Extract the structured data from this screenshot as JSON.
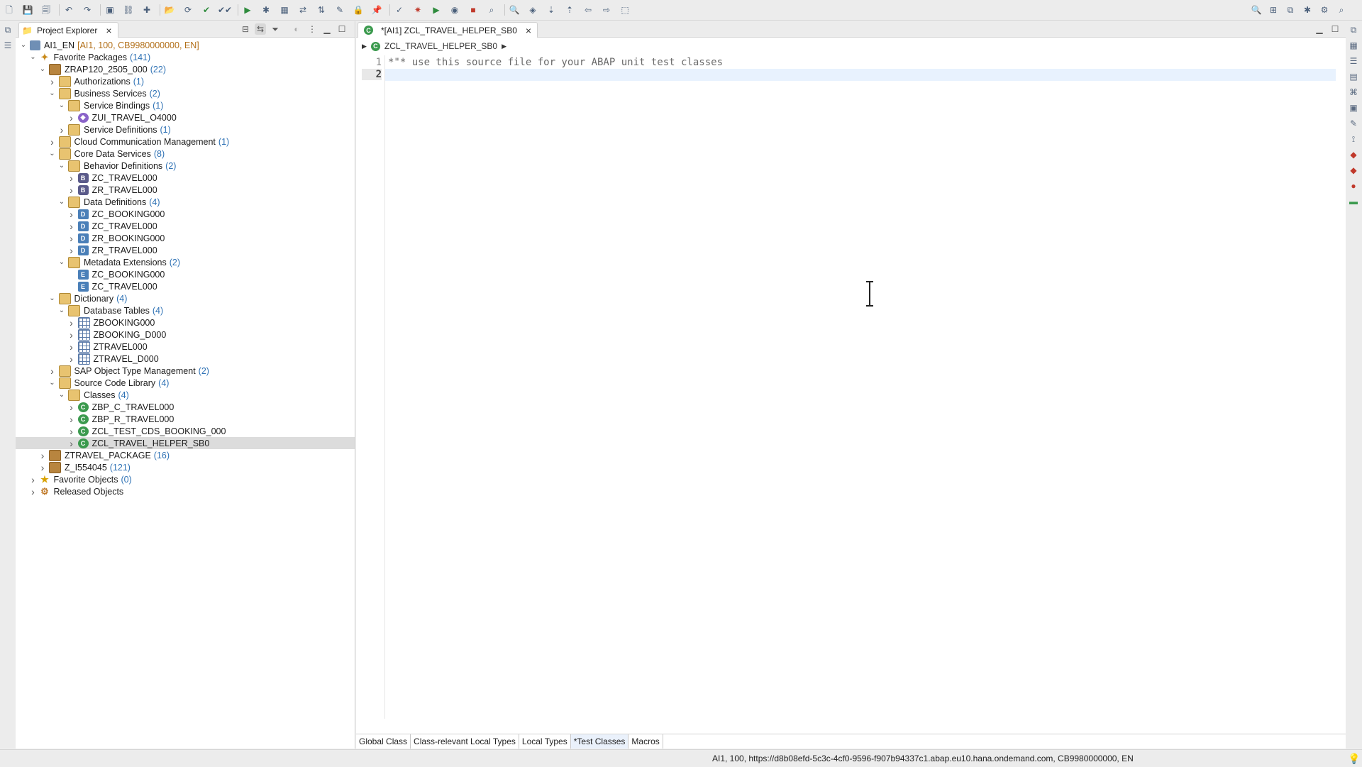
{
  "toolbar": {
    "left_icons": [
      "new-icon",
      "save-icon",
      "save-all-icon",
      "undo-icon",
      "redo-icon",
      "open-console-icon",
      "link-icon",
      "new-abap-object-icon",
      "open-abap-icon",
      "refresh-icon",
      "activate-icon",
      "activate-all-icon",
      "run-icon",
      "debug-icon",
      "package-icon",
      "transport-icon",
      "sync-icon",
      "edit-icon",
      "lock-icon",
      "pin-icon",
      "mark-icon",
      "bug-icon",
      "run-menu-icon",
      "coverage-icon",
      "stop-icon",
      "open-type-icon",
      "search-icon",
      "annotation-icon",
      "next-annotation-icon",
      "prev-annotation-icon",
      "back-icon",
      "forward-icon",
      "maximize-editor-icon"
    ],
    "right_icons": [
      "search-icon",
      "open-perspective-icon",
      "abap-perspective-icon",
      "debug-perspective-icon",
      "settings-icon",
      "search-perspective-icon"
    ]
  },
  "explorer": {
    "title": "Project Explorer",
    "tree": [
      {
        "depth": 0,
        "twisty": "open",
        "icon": "project",
        "name": "AI1_EN",
        "meta": "[AI1, 100, CB9980000000, EN]"
      },
      {
        "depth": 1,
        "twisty": "open",
        "icon": "fav",
        "name": "Favorite Packages",
        "count": "(141)"
      },
      {
        "depth": 2,
        "twisty": "open",
        "icon": "package",
        "name": "ZRAP120_2505_000",
        "count": "(22)"
      },
      {
        "depth": 3,
        "twisty": "closed",
        "icon": "folder",
        "name": "Authorizations",
        "count": "(1)"
      },
      {
        "depth": 3,
        "twisty": "open",
        "icon": "folder",
        "name": "Business Services",
        "count": "(2)"
      },
      {
        "depth": 4,
        "twisty": "open",
        "icon": "folder",
        "name": "Service Bindings",
        "count": "(1)"
      },
      {
        "depth": 5,
        "twisty": "closed",
        "icon": "binding",
        "name": "ZUI_TRAVEL_O4000"
      },
      {
        "depth": 4,
        "twisty": "closed",
        "icon": "folder",
        "name": "Service Definitions",
        "count": "(1)"
      },
      {
        "depth": 3,
        "twisty": "closed",
        "icon": "folder",
        "name": "Cloud Communication Management",
        "count": "(1)"
      },
      {
        "depth": 3,
        "twisty": "open",
        "icon": "folder",
        "name": "Core Data Services",
        "count": "(8)"
      },
      {
        "depth": 4,
        "twisty": "open",
        "icon": "folder",
        "name": "Behavior Definitions",
        "count": "(2)"
      },
      {
        "depth": 5,
        "twisty": "closed",
        "icon": "bdef",
        "glyph": "B",
        "name": "ZC_TRAVEL000"
      },
      {
        "depth": 5,
        "twisty": "closed",
        "icon": "bdef",
        "glyph": "B",
        "name": "ZR_TRAVEL000"
      },
      {
        "depth": 4,
        "twisty": "open",
        "icon": "folder",
        "name": "Data Definitions",
        "count": "(4)"
      },
      {
        "depth": 5,
        "twisty": "closed",
        "icon": "ddl",
        "glyph": "D",
        "name": "ZC_BOOKING000"
      },
      {
        "depth": 5,
        "twisty": "closed",
        "icon": "ddl",
        "glyph": "D",
        "name": "ZC_TRAVEL000"
      },
      {
        "depth": 5,
        "twisty": "closed",
        "icon": "ddl",
        "glyph": "D",
        "name": "ZR_BOOKING000"
      },
      {
        "depth": 5,
        "twisty": "closed",
        "icon": "ddl",
        "glyph": "D",
        "name": "ZR_TRAVEL000"
      },
      {
        "depth": 4,
        "twisty": "open",
        "icon": "folder",
        "name": "Metadata Extensions",
        "count": "(2)"
      },
      {
        "depth": 5,
        "twisty": "none",
        "icon": "ext",
        "glyph": "E",
        "name": "ZC_BOOKING000"
      },
      {
        "depth": 5,
        "twisty": "none",
        "icon": "ext",
        "glyph": "E",
        "name": "ZC_TRAVEL000"
      },
      {
        "depth": 3,
        "twisty": "open",
        "icon": "folder",
        "name": "Dictionary",
        "count": "(4)"
      },
      {
        "depth": 4,
        "twisty": "open",
        "icon": "folder",
        "name": "Database Tables",
        "count": "(4)"
      },
      {
        "depth": 5,
        "twisty": "closed",
        "icon": "table",
        "name": "ZBOOKING000"
      },
      {
        "depth": 5,
        "twisty": "closed",
        "icon": "table",
        "name": "ZBOOKING_D000"
      },
      {
        "depth": 5,
        "twisty": "closed",
        "icon": "table",
        "name": "ZTRAVEL000"
      },
      {
        "depth": 5,
        "twisty": "closed",
        "icon": "table",
        "name": "ZTRAVEL_D000"
      },
      {
        "depth": 3,
        "twisty": "closed",
        "icon": "folder",
        "name": "SAP Object Type Management",
        "count": "(2)"
      },
      {
        "depth": 3,
        "twisty": "open",
        "icon": "folder",
        "name": "Source Code Library",
        "count": "(4)"
      },
      {
        "depth": 4,
        "twisty": "open",
        "icon": "folder",
        "name": "Classes",
        "count": "(4)"
      },
      {
        "depth": 5,
        "twisty": "closed",
        "icon": "class",
        "glyph": "C",
        "name": "ZBP_C_TRAVEL000"
      },
      {
        "depth": 5,
        "twisty": "closed",
        "icon": "class",
        "glyph": "C",
        "name": "ZBP_R_TRAVEL000"
      },
      {
        "depth": 5,
        "twisty": "closed",
        "icon": "class",
        "glyph": "C",
        "name": "ZCL_TEST_CDS_BOOKING_000"
      },
      {
        "depth": 5,
        "twisty": "closed",
        "icon": "class",
        "glyph": "C",
        "name": "ZCL_TRAVEL_HELPER_SB0",
        "selected": true
      },
      {
        "depth": 2,
        "twisty": "closed",
        "icon": "package",
        "name": "ZTRAVEL_PACKAGE",
        "count": "(16)"
      },
      {
        "depth": 2,
        "twisty": "closed",
        "icon": "package",
        "name": "Z_I554045",
        "count": "(121)"
      },
      {
        "depth": 1,
        "twisty": "closed",
        "icon": "star",
        "name": "Favorite Objects",
        "count": "(0)"
      },
      {
        "depth": 1,
        "twisty": "closed",
        "icon": "gear",
        "name": "Released Objects"
      }
    ]
  },
  "editor": {
    "tab_title": "*[AI1] ZCL_TRAVEL_HELPER_SB0",
    "breadcrumb": "ZCL_TRAVEL_HELPER_SB0",
    "lines": [
      {
        "num": "1",
        "text": "*\"* use this source file for your ABAP unit test classes"
      },
      {
        "num": "2",
        "text": ""
      }
    ],
    "bottom_tabs": [
      "Global Class",
      "Class-relevant Local Types",
      "Local Types",
      "*Test Classes",
      "Macros"
    ],
    "active_bottom_tab": "*Test Classes"
  },
  "status": {
    "text": "AI1, 100, https://d8b08efd-5c3c-4cf0-9596-f907b94337c1.abap.eu10.hana.ondemand.com, CB9980000000, EN"
  }
}
